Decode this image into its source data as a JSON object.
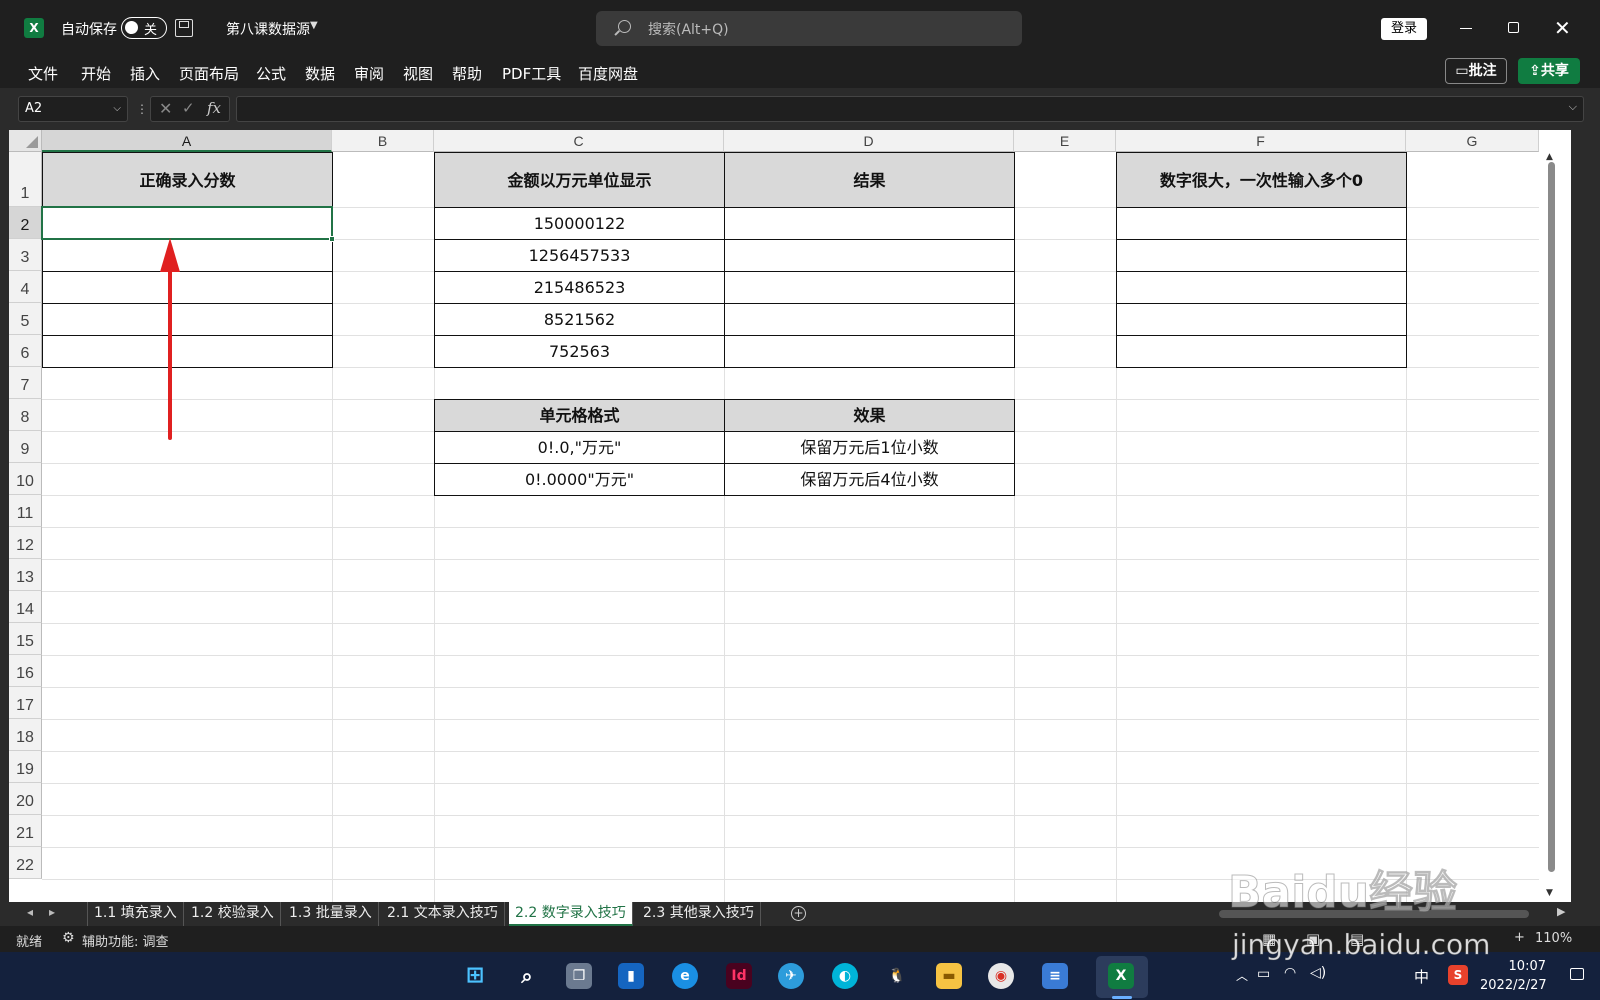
{
  "titlebar": {
    "autosave_label": "自动保存",
    "autosave_state": "关",
    "doc_title": "第八课数据源",
    "search_placeholder": "搜索(Alt+Q)",
    "login_label": "登录"
  },
  "menu": {
    "items": [
      "文件",
      "开始",
      "插入",
      "页面布局",
      "公式",
      "数据",
      "审阅",
      "视图",
      "帮助",
      "PDF工具",
      "百度网盘"
    ],
    "comment_label": "批注",
    "share_label": "共享"
  },
  "formula_bar": {
    "name_box": "A2",
    "fx_label": "fx",
    "value": ""
  },
  "columns": [
    "A",
    "B",
    "C",
    "D",
    "E",
    "F",
    "G"
  ],
  "rows": [
    "1",
    "2",
    "3",
    "4",
    "5",
    "6",
    "7",
    "8",
    "9",
    "10",
    "11",
    "12",
    "13",
    "14",
    "15",
    "16",
    "17",
    "18",
    "19",
    "20",
    "21",
    "22"
  ],
  "cells": {
    "A1": "正确录入分数",
    "C1": "金额以万元单位显示",
    "D1": "结果",
    "F1": "数字很大，一次性输入多个0",
    "C2": "150000122",
    "C3": "1256457533",
    "C4": "215486523",
    "C5": "8521562",
    "C6": "752563",
    "C8": "单元格格式",
    "D8": "效果",
    "C9": "0!.0,\"万元\"",
    "D9": "保留万元后1位小数",
    "C10": "0!.0000\"万元\"",
    "D10": "保留万元后4位小数"
  },
  "sheet_tabs": [
    "1.1 填充录入",
    "1.2 校验录入",
    "1.3 批量录入",
    "2.1 文本录入技巧",
    "2.2 数字录入技巧",
    "2.3 其他录入技巧"
  ],
  "active_tab": "2.2 数字录入技巧",
  "status": {
    "ready": "就绪",
    "accessibility": "辅助功能: 调查",
    "zoom": "110%"
  },
  "taskbar": {
    "ime": "中",
    "time": "10:07",
    "date": "2022/2/27"
  },
  "watermark": {
    "logo": "Baidu经验",
    "url": "jingyan.baidu.com"
  },
  "colors": {
    "excel_green": "#217346",
    "share_green": "#107c41",
    "annotation_arrow": "#e02020"
  }
}
